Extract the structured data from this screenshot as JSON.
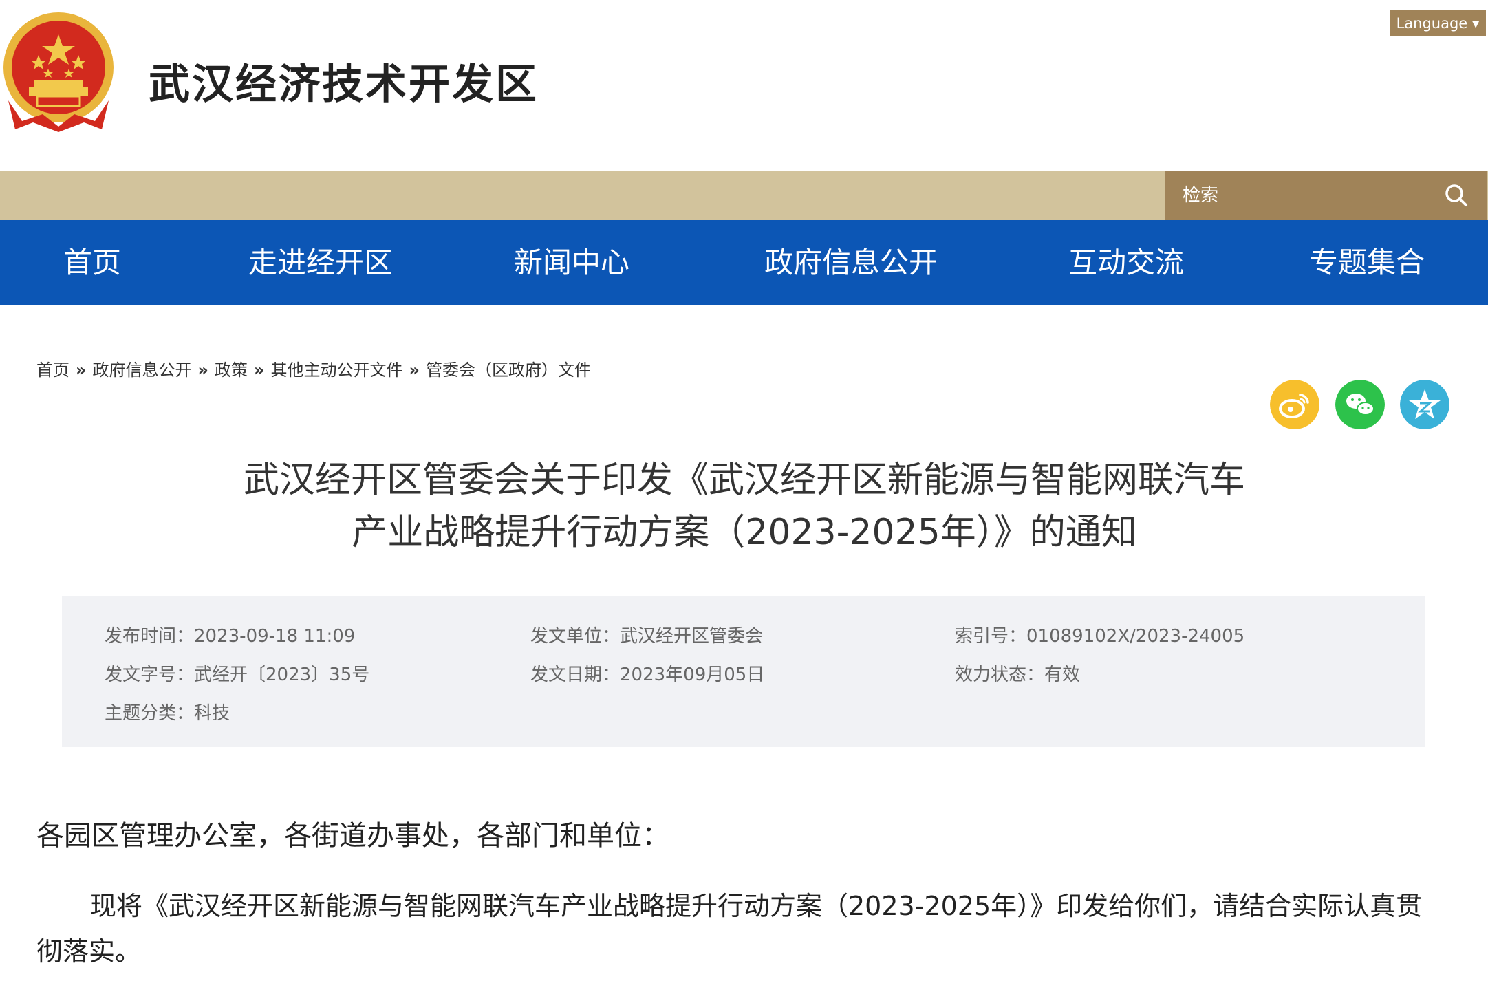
{
  "header": {
    "site_title": "武汉经济技术开发区",
    "language_label": "Language ▾"
  },
  "search": {
    "placeholder": "检索"
  },
  "nav": {
    "items": [
      "首页",
      "走进经开区",
      "新闻中心",
      "政府信息公开",
      "互动交流",
      "专题集合"
    ]
  },
  "breadcrumb": {
    "items": [
      "首页",
      "政府信息公开",
      "政策",
      "其他主动公开文件",
      "管委会（区政府）文件"
    ],
    "separator": "»"
  },
  "share": {
    "icons": [
      "weibo-icon",
      "wechat-icon",
      "qzone-icon"
    ]
  },
  "article": {
    "title_line1": "武汉经开区管委会关于印发《武汉经开区新能源与智能网联汽车",
    "title_line2": "产业战略提升行动方案（2023-2025年）》的通知",
    "greeting": "各园区管理办公室，各街道办事处，各部门和单位：",
    "body": "现将《武汉经开区新能源与智能网联汽车产业战略提升行动方案（2023-2025年）》印发给你们，请结合实际认真贯彻落实。"
  },
  "meta": {
    "publish_time_label": "发布时间：",
    "publish_time": "2023-09-18 11:09",
    "issuer_label": "发文单位：",
    "issuer": "武汉经开区管委会",
    "index_label": "索引号：",
    "index_no": "01089102X/2023-24005",
    "doc_no_label": "发文字号：",
    "doc_no": "武经开〔2023〕35号",
    "issue_date_label": "发文日期：",
    "issue_date": "2023年09月05日",
    "status_label": "效力状态：",
    "status": "有效",
    "topic_label": "主题分类：",
    "topic": "科技"
  },
  "colors": {
    "nav_blue": "#0c56b5",
    "tan_bar": "#d2c39c",
    "search_brown": "#a08358",
    "weibo_yellow": "#f7bf2c",
    "wechat_green": "#2dc24b",
    "qzone_teal": "#3ab1d8"
  }
}
